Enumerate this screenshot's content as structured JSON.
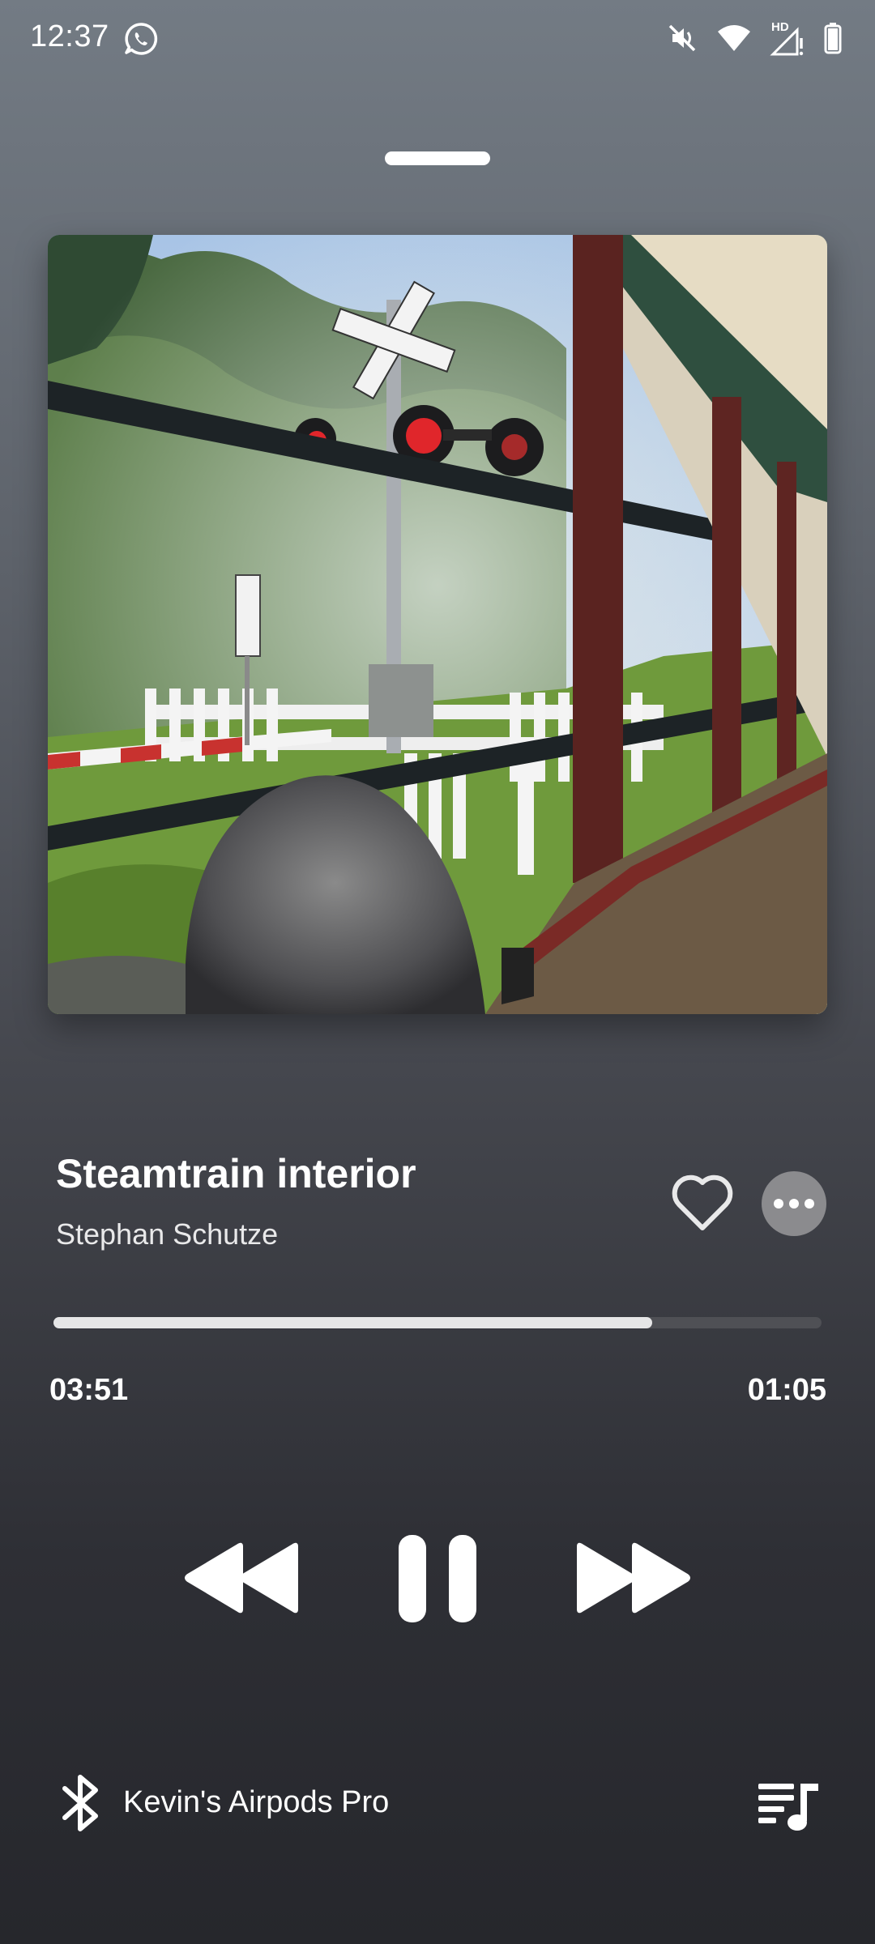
{
  "status_bar": {
    "time": "12:37",
    "icons": [
      "whatsapp-icon",
      "mute-icon",
      "wifi-icon",
      "cellular-hd-icon",
      "battery-icon"
    ],
    "signal_badge": "HD"
  },
  "now_playing": {
    "artwork": "album-art-photo",
    "title": "Steamtrain interior",
    "artist": "Stephan Schutze",
    "liked": false,
    "progress_fraction": 0.78,
    "elapsed": "03:51",
    "remaining": "01:05",
    "state": "playing"
  },
  "output_device": {
    "name": "Kevin's Airpods Pro",
    "icon": "bluetooth-icon"
  },
  "colors": {
    "accent": "#ffffff",
    "progress_fill": "#e6e6e7",
    "progress_track": "#4f5055",
    "more_button_bg": "#8b8b8e"
  }
}
